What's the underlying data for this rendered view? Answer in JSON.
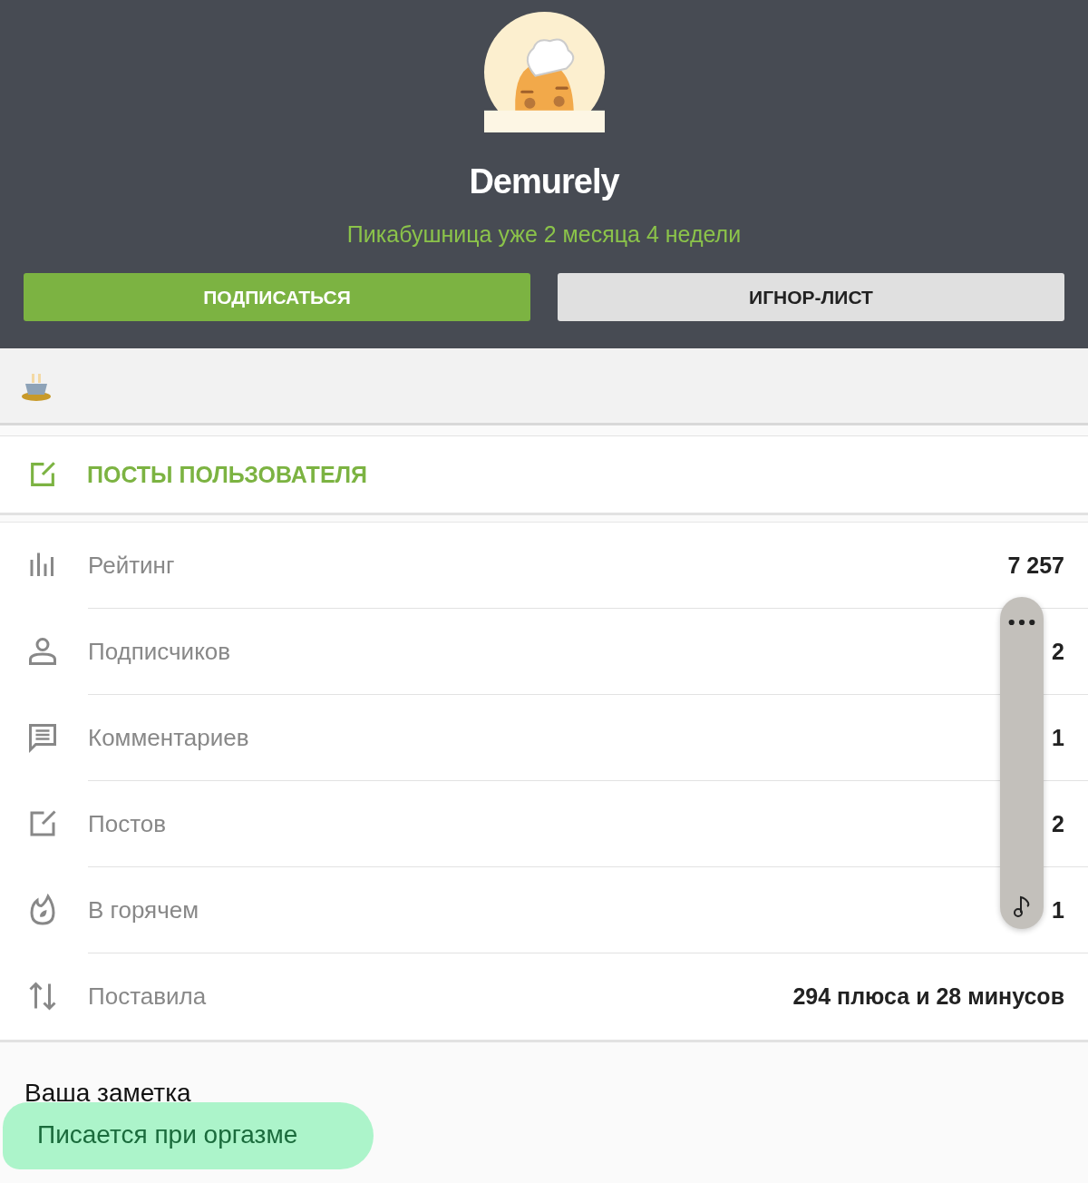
{
  "profile": {
    "name": "Demurely",
    "tenure": "Пикабушница уже 2 месяца 4 недели"
  },
  "buttons": [
    {
      "label": "ПОДПИСАТЬСЯ",
      "kind": "primary"
    },
    {
      "label": "ИГНОР-ЛИСТ",
      "kind": "secondary"
    }
  ],
  "posts_link": {
    "label": "ПОСТЫ ПОЛЬЗОВАТЕЛЯ"
  },
  "stats": [
    {
      "kind": "rating",
      "label": "Рейтинг",
      "value": "7 257"
    },
    {
      "kind": "subscribers",
      "label": "Подписчиков",
      "value": "2"
    },
    {
      "kind": "comments",
      "label": "Комментариев",
      "value": "1"
    },
    {
      "kind": "posts",
      "label": "Постов",
      "value": "2"
    },
    {
      "kind": "hot",
      "label": "В горячем",
      "value": "1"
    },
    {
      "kind": "votes",
      "label": "Поставила",
      "value": "294 плюса и 28 минусов"
    }
  ],
  "note": {
    "title": "Ваша заметка",
    "text": "Писается при оргазме"
  }
}
